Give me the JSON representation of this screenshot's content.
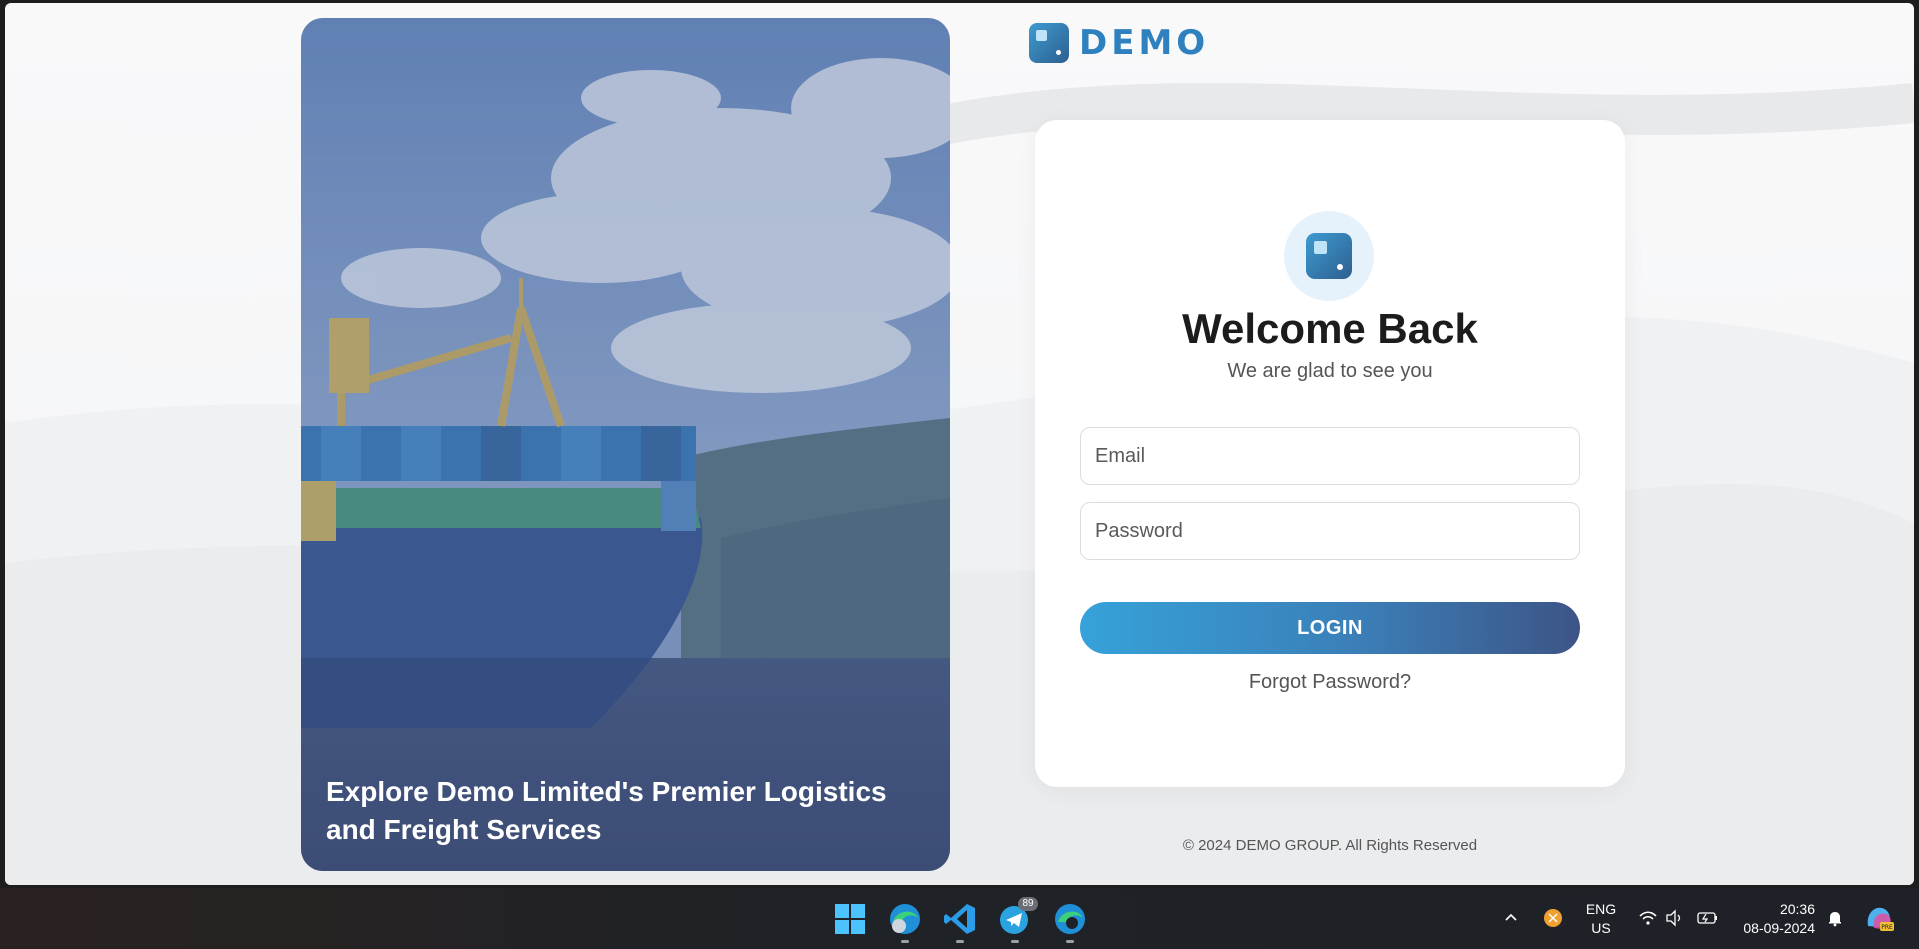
{
  "brand": {
    "logo_text": "DEMO"
  },
  "hero": {
    "caption": "Explore Demo Limited's Premier Logistics and Freight Services"
  },
  "login": {
    "title": "Welcome Back",
    "subtitle": "We are glad to see you",
    "email_placeholder": "Email",
    "password_placeholder": "Password",
    "login_label": "LOGIN",
    "forgot_label": "Forgot Password?"
  },
  "footer": {
    "copyright": "© 2024 DEMO GROUP. All Rights Reserved"
  },
  "taskbar": {
    "apps": [
      "start-icon",
      "edge-profile-icon",
      "vscode-icon",
      "telegram-icon",
      "edge-icon"
    ],
    "telegram_badge": "89",
    "language_line1": "ENG",
    "language_line2": "US",
    "time": "20:36",
    "date": "08-09-2024"
  },
  "colors": {
    "accent": "#3a8fcc",
    "button_start": "#36a2d9",
    "button_end": "#3d5486"
  }
}
